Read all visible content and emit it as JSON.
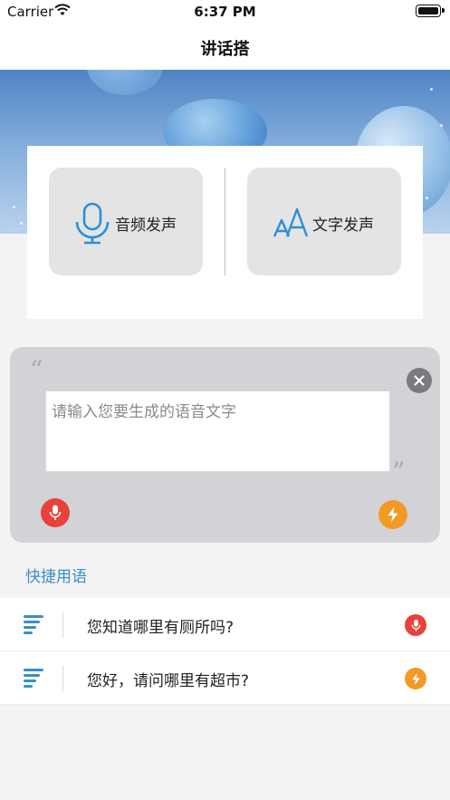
{
  "status_bar": {
    "carrier": "Carrier",
    "time": "6:37 PM"
  },
  "nav": {
    "title": "讲话搭"
  },
  "modes": {
    "audio_label": "音频发声",
    "text_label": "文字发声"
  },
  "editor": {
    "placeholder": "请输入您要生成的语音文字",
    "value": ""
  },
  "quick_phrases": {
    "title": "快捷用语",
    "items": [
      {
        "text": "您知道哪里有厕所吗?",
        "action_icon": "mic-icon"
      },
      {
        "text": "您好，请问哪里有超市?",
        "action_icon": "bolt-icon"
      }
    ]
  },
  "colors": {
    "accent_blue": "#3a8ec6",
    "mic_red": "#e8423a",
    "bolt_orange": "#f29a24",
    "panel_gray": "#d3d3d7"
  }
}
